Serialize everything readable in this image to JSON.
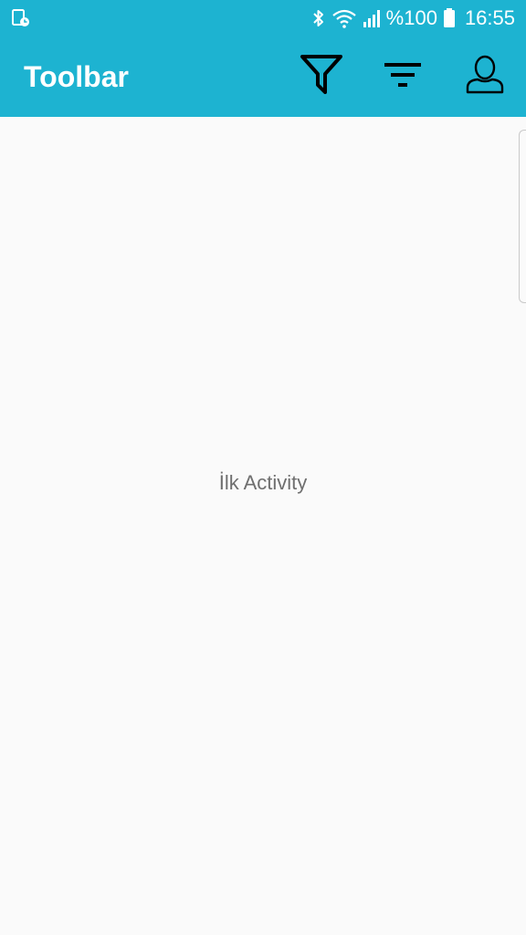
{
  "status_bar": {
    "left_icon": "screenshot-notification-icon",
    "icons": [
      "bluetooth-icon",
      "wifi-icon",
      "signal-icon"
    ],
    "battery_text": "%100",
    "battery_icon": "battery-icon",
    "time": "16:55",
    "background": "#1db3d1"
  },
  "toolbar": {
    "title": "Toolbar",
    "actions": [
      {
        "icon": "filter-funnel-icon"
      },
      {
        "icon": "sort-lines-icon"
      },
      {
        "icon": "person-icon"
      }
    ],
    "background": "#1db3d1"
  },
  "content": {
    "center_text": "İlk Activity"
  }
}
